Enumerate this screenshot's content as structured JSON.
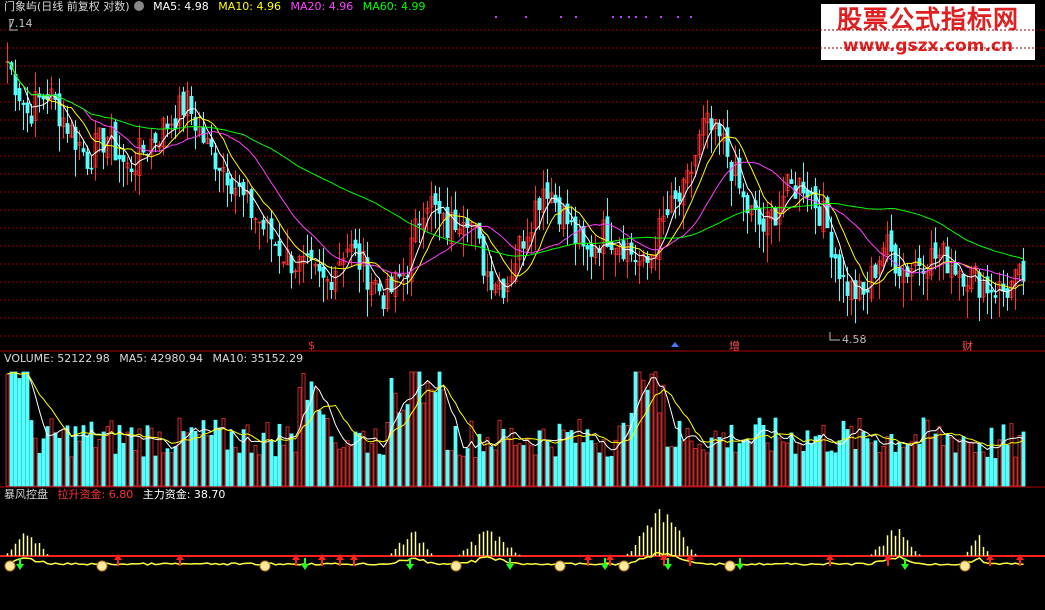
{
  "price_header": {
    "title": "门象屿(日线 前复权 对数)",
    "ma5": "MA5: 4.98",
    "ma10": "MA10: 4.96",
    "ma20": "MA20: 4.96",
    "ma60": "MA60: 4.99"
  },
  "price_annotations": {
    "high": "7.14",
    "low": "4.58",
    "mark_s": "$",
    "mark_zeng": "增",
    "mark_cai": "财"
  },
  "volume_header": {
    "volume": "VOLUME: 52122.98",
    "ma5": "MA5: 42980.94",
    "ma10": "MA10: 35152.29"
  },
  "indicator_header": {
    "name": "暴风控盘",
    "lift": "拉升资金: 6.80",
    "main": "主力资金: 38.70"
  },
  "watermark": {
    "line1": "股票公式指标网",
    "line2": "www.gszx.com.cn"
  },
  "colors": {
    "up": "#ff3232",
    "down": "#54ffff",
    "ma5": "#ffffff",
    "ma10": "#ffff00",
    "ma20": "#ff40ff",
    "ma60": "#00ff00",
    "grid": "#8b0000",
    "label": "#c0c0c0"
  },
  "chart_data": [
    {
      "type": "candlestick",
      "name": "price",
      "scale": "log",
      "y_range": [
        4.58,
        7.14
      ],
      "series": [
        "MA5",
        "MA10",
        "MA20",
        "MA60"
      ],
      "close_path": [
        6.8,
        6.3,
        6.5,
        6.2,
        5.9,
        6.1,
        5.8,
        6.0,
        6.2,
        6.4,
        6.0,
        5.8,
        5.5,
        5.3,
        5.1,
        5.0,
        4.9,
        5.2,
        5.0,
        4.8,
        5.0,
        5.6,
        5.3,
        5.5,
        5.0,
        4.9,
        5.3,
        5.7,
        5.4,
        5.1,
        5.3,
        5.2,
        5.0,
        5.4,
        5.6,
        6.2,
        6.0,
        5.5,
        5.3,
        5.6,
        5.7,
        5.4,
        4.9,
        4.8,
        5.2,
        5.0,
        5.1,
        5.1,
        5.0,
        4.9,
        4.85,
        4.95
      ]
    },
    {
      "type": "bar",
      "name": "volume",
      "series": [
        "VOLUME",
        "MA5",
        "MA10"
      ],
      "values_hint": [
        52122.98,
        42980.94,
        35152.29
      ]
    },
    {
      "type": "bar",
      "name": "暴风控盘",
      "series": [
        "拉升资金",
        "主力资金"
      ],
      "values_hint": [
        6.8,
        38.7
      ]
    }
  ]
}
